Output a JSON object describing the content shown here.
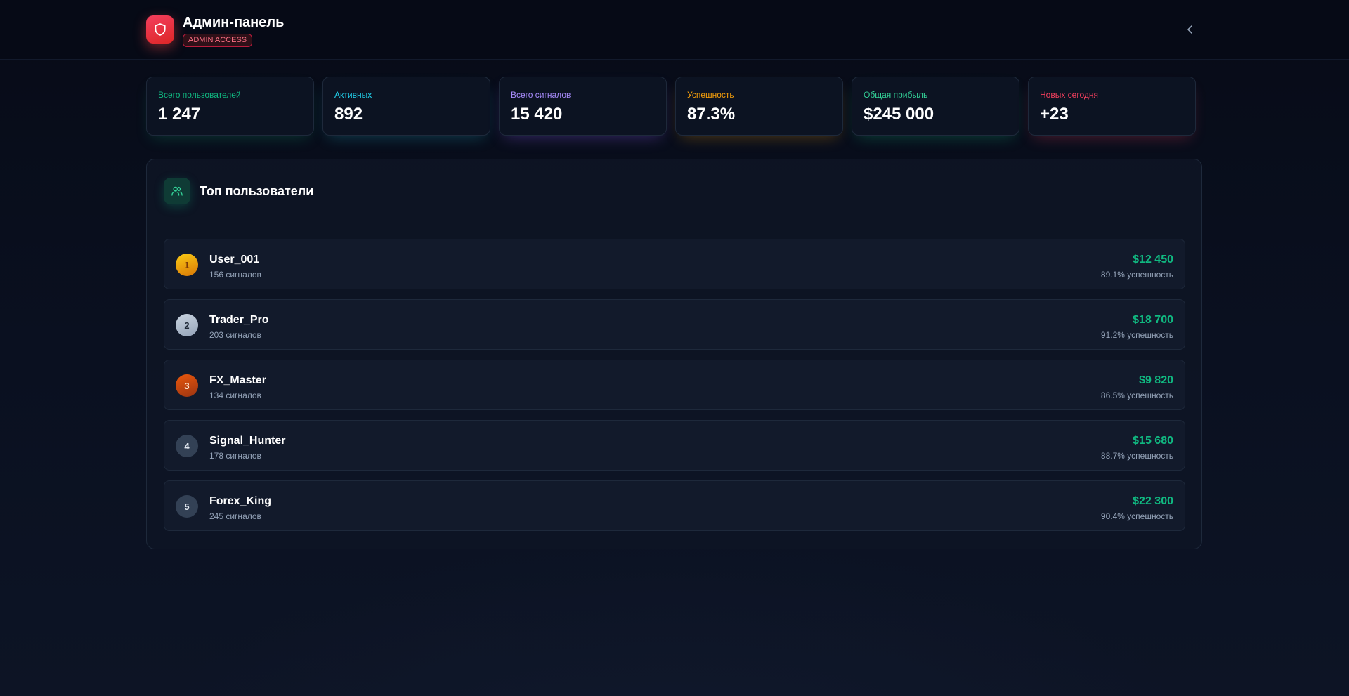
{
  "header": {
    "title": "Админ-панель",
    "badge": "ADMIN ACCESS",
    "back_icon": "chevron-left-icon",
    "logo_icon": "shield-icon"
  },
  "stats": [
    {
      "label": "Всего пользователей",
      "value": "1 247",
      "color": "#10b981",
      "glow": "rgba(16,185,129,0.25)"
    },
    {
      "label": "Активных",
      "value": "892",
      "color": "#22d3ee",
      "glow": "rgba(34,211,238,0.25)"
    },
    {
      "label": "Всего сигналов",
      "value": "15 420",
      "color": "#a78bfa",
      "glow": "rgba(139,92,246,0.35)"
    },
    {
      "label": "Успешность",
      "value": "87.3%",
      "color": "#f59e0b",
      "glow": "rgba(245,158,11,0.3)"
    },
    {
      "label": "Общая прибыль",
      "value": "$245 000",
      "color": "#34d399",
      "glow": "rgba(16,185,129,0.3)"
    },
    {
      "label": "Новых сегодня",
      "value": "+23",
      "color": "#f43f5e",
      "glow": "rgba(244,63,94,0.3)"
    }
  ],
  "top_users": {
    "title": "Топ пользователи",
    "icon": "users-icon",
    "rows": [
      {
        "rank": "1",
        "name": "User_001",
        "signals": "156 сигналов",
        "profit": "$12 450",
        "rate": "89.1% успешность"
      },
      {
        "rank": "2",
        "name": "Trader_Pro",
        "signals": "203 сигналов",
        "profit": "$18 700",
        "rate": "91.2% успешность"
      },
      {
        "rank": "3",
        "name": "FX_Master",
        "signals": "134 сигналов",
        "profit": "$9 820",
        "rate": "86.5% успешность"
      },
      {
        "rank": "4",
        "name": "Signal_Hunter",
        "signals": "178 сигналов",
        "profit": "$15 680",
        "rate": "88.7% успешность"
      },
      {
        "rank": "5",
        "name": "Forex_King",
        "signals": "245 сигналов",
        "profit": "$22 300",
        "rate": "90.4% успешность"
      }
    ]
  }
}
